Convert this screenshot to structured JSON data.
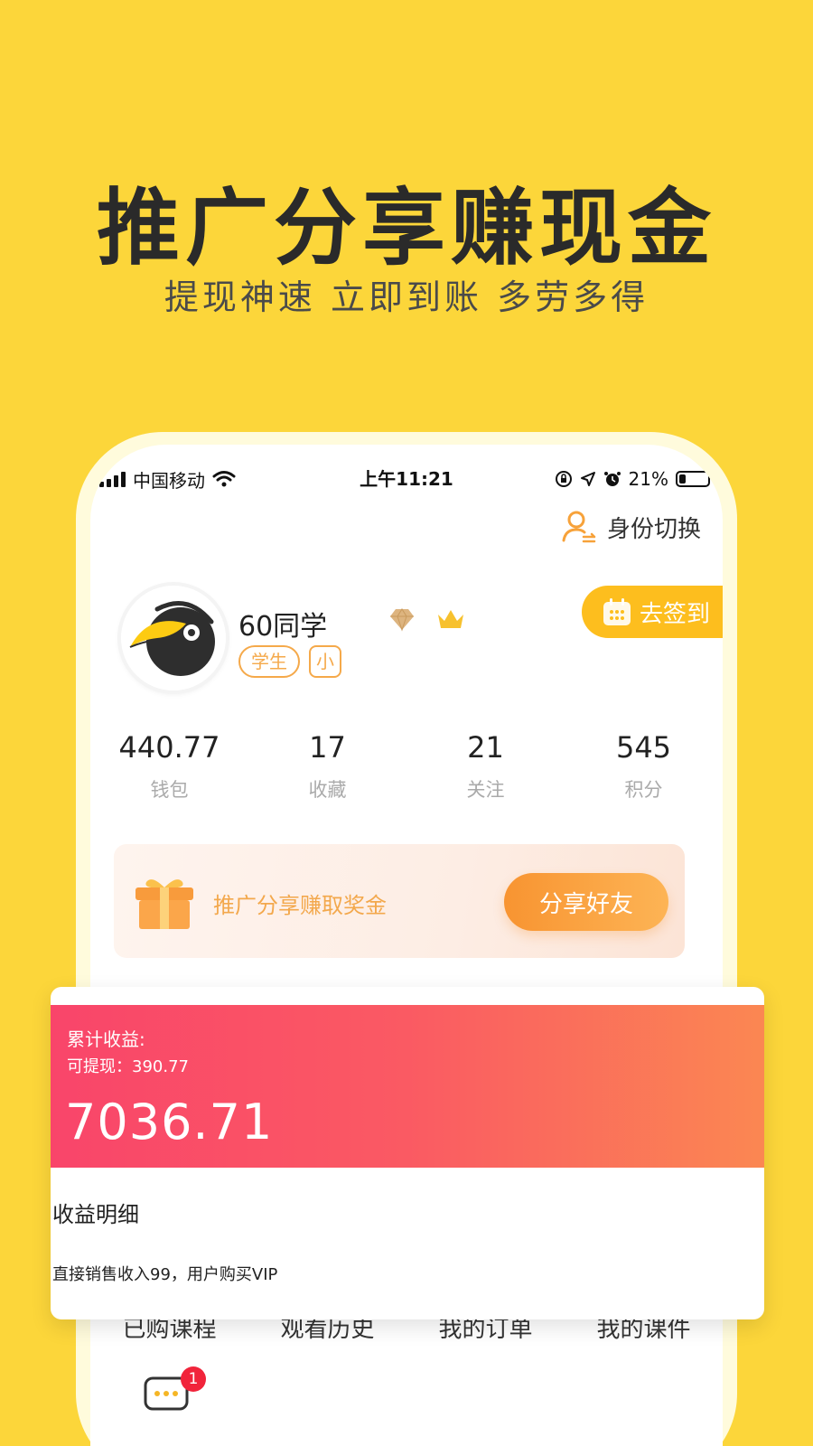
{
  "headline": "推广分享赚现金",
  "subline": "提现神速  立即到账  多劳多得",
  "status_bar": {
    "carrier": "中国移动",
    "time": "上午11:21",
    "battery": "21%"
  },
  "profile": {
    "identity_switch": "身份切换",
    "name": "60同学",
    "tags": [
      "学生",
      "小"
    ],
    "checkin": "去签到"
  },
  "stats": [
    {
      "value": "440.77",
      "label": "钱包"
    },
    {
      "value": "17",
      "label": "收藏"
    },
    {
      "value": "21",
      "label": "关注"
    },
    {
      "value": "545",
      "label": "积分"
    }
  ],
  "promo": {
    "text": "推广分享赚取奖金",
    "button": "分享好友"
  },
  "earnings": {
    "total_label": "累计收益:",
    "withdrawable": "可提现：390.77",
    "total": "7036.71",
    "detail_title": "收益明细",
    "detail_row": "直接销售收入99，用户购买VIP"
  },
  "menu": [
    "已购课程",
    "观看历史",
    "我的订单",
    "我的课件"
  ],
  "message_badge": "1",
  "colors": {
    "background": "#FCD63A",
    "accent_orange": "#F89431",
    "earnings_gradient_start": "#F9456A",
    "earnings_gradient_end": "#FB8752"
  }
}
